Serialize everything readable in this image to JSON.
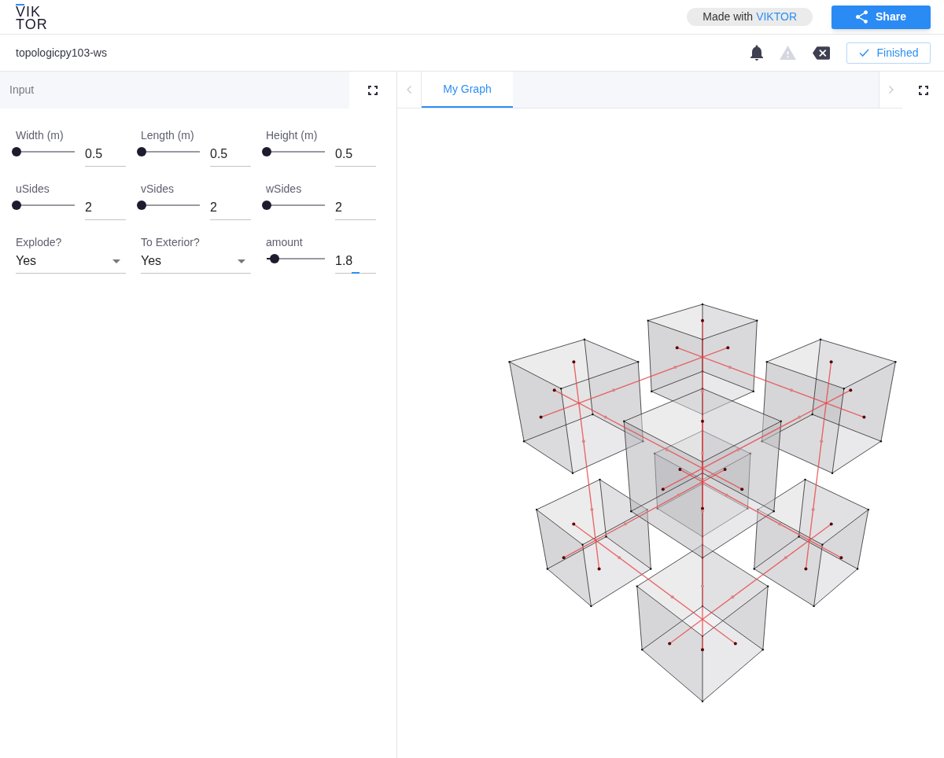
{
  "header": {
    "logo": [
      "VIK",
      "TOR"
    ],
    "made_with": {
      "text": "Made with",
      "brand": "VIKTOR"
    },
    "share_button": {
      "label": "Share"
    }
  },
  "toolbar": {
    "title": "topologicpy103-ws",
    "icons": [
      {
        "kind": "bell",
        "disabled": false
      },
      {
        "kind": "warning",
        "disabled": true
      },
      {
        "kind": "clear",
        "disabled": false
      }
    ],
    "status_button": {
      "label": "Finished"
    }
  },
  "input_panel": {
    "title": "Input",
    "fields": [
      {
        "kind": "slider",
        "label": "Width (m)",
        "level": 0,
        "value": "0.5",
        "focused": false
      },
      {
        "kind": "slider",
        "label": "Length (m)",
        "level": 0,
        "value": "0.5",
        "focused": false
      },
      {
        "kind": "slider",
        "label": "Height (m)",
        "level": 0,
        "value": "0.5",
        "focused": false
      },
      {
        "kind": "slider",
        "label": "uSides",
        "level": 0,
        "value": "2",
        "focused": false
      },
      {
        "kind": "slider",
        "label": "vSides",
        "level": 0,
        "value": "2",
        "focused": false
      },
      {
        "kind": "slider",
        "label": "wSides",
        "level": 0,
        "value": "2",
        "focused": false
      },
      {
        "kind": "select",
        "label": "Explode?",
        "value": "Yes"
      },
      {
        "kind": "select",
        "label": "To Exterior?",
        "value": "Yes"
      },
      {
        "kind": "slider",
        "label": "amount",
        "level": 0.14,
        "value": "1.8",
        "focused": true
      }
    ]
  },
  "viewer": {
    "tabs": [
      {
        "label": "My Graph",
        "selected": true
      }
    ]
  }
}
